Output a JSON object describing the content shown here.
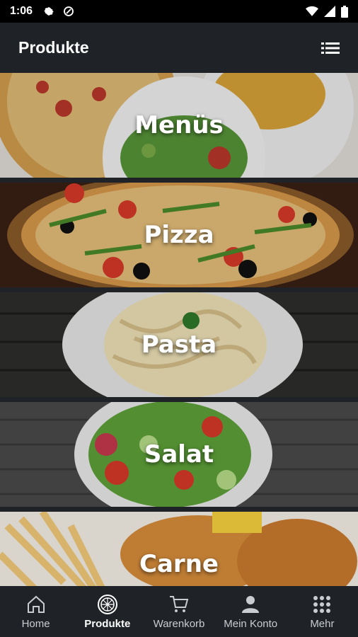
{
  "status_bar": {
    "time": "1:06"
  },
  "app_bar": {
    "title": "Produkte"
  },
  "categories": [
    {
      "label": "Menüs"
    },
    {
      "label": "Pizza"
    },
    {
      "label": "Pasta"
    },
    {
      "label": "Salat"
    },
    {
      "label": "Carne"
    }
  ],
  "bottom_nav": {
    "items": [
      {
        "label": "Home",
        "icon": "home-icon"
      },
      {
        "label": "Produkte",
        "icon": "pizza-icon",
        "active": true
      },
      {
        "label": "Warenkorb",
        "icon": "cart-icon"
      },
      {
        "label": "Mein Konto",
        "icon": "account-icon"
      },
      {
        "label": "Mehr",
        "icon": "grid-icon"
      }
    ]
  }
}
